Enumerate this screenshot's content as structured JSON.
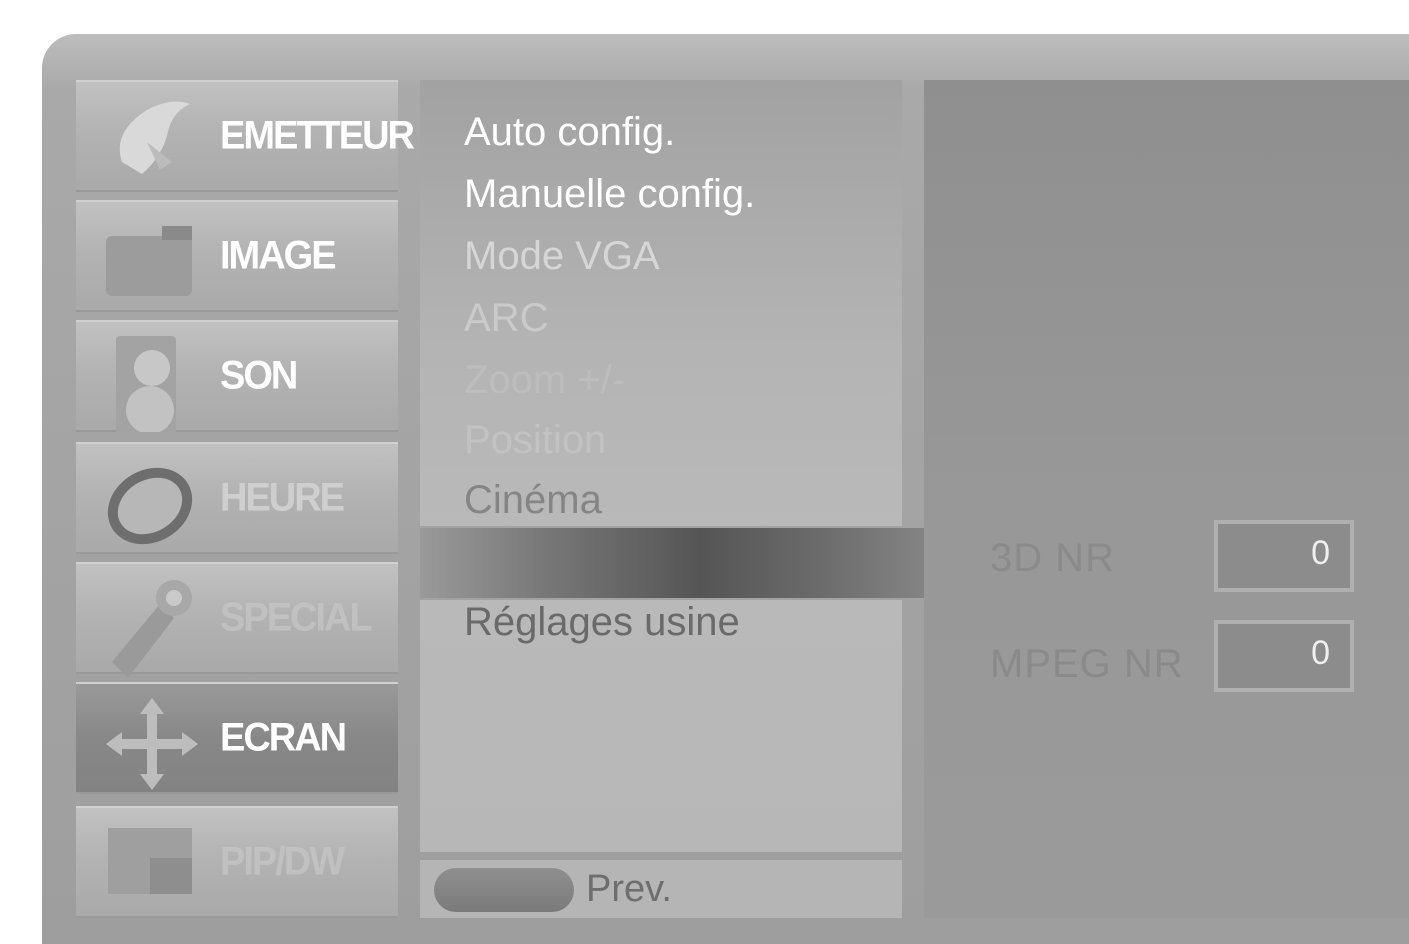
{
  "tabs": [
    {
      "label": "EMETTEUR",
      "icon": "satellite-dish-icon",
      "state": "normal"
    },
    {
      "label": "IMAGE",
      "icon": "picture-icon",
      "state": "normal"
    },
    {
      "label": "SON",
      "icon": "speaker-icon",
      "state": "normal"
    },
    {
      "label": "HEURE",
      "icon": "clock-icon",
      "state": "dim"
    },
    {
      "label": "SPECIAL",
      "icon": "wrench-icon",
      "state": "faint"
    },
    {
      "label": "ECRAN",
      "icon": "move-arrows-icon",
      "state": "selected"
    },
    {
      "label": "PIP/DW",
      "icon": "pip-icon",
      "state": "faint"
    }
  ],
  "menu": {
    "items": [
      {
        "label": "Auto config.",
        "color": "#ffffff"
      },
      {
        "label": "Manuelle config.",
        "color": "#ffffff"
      },
      {
        "label": "Mode VGA",
        "color": "#d6d6d6"
      },
      {
        "label": "ARC",
        "color": "#cacaca"
      },
      {
        "label": "Zoom +/-",
        "color": "#bdbdbd"
      },
      {
        "label": "Position",
        "color": "#c2c2c2"
      },
      {
        "label": "Cinéma",
        "color": "#858585"
      }
    ],
    "after_highlight": {
      "label": "Réglages usine",
      "color": "#6a6a6a"
    }
  },
  "footer": {
    "prev_label": "Prev."
  },
  "noise_reduction": [
    {
      "label": "3D NR",
      "value": "0"
    },
    {
      "label": "MPEG NR",
      "value": "0"
    }
  ]
}
